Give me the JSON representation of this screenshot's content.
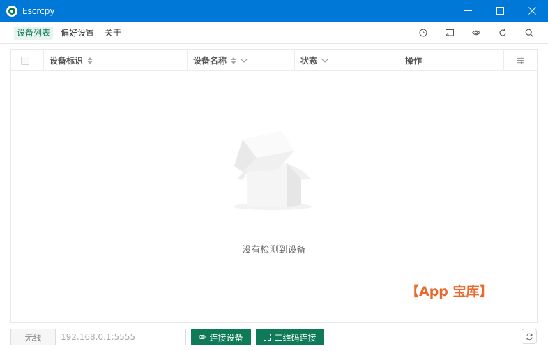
{
  "window": {
    "title": "Escrcpy",
    "controls": [
      "minimize-icon",
      "maximize-icon",
      "close-icon"
    ]
  },
  "menu": {
    "items": [
      {
        "label": "设备列表",
        "active": true
      },
      {
        "label": "偏好设置",
        "active": false
      },
      {
        "label": "关于",
        "active": false
      }
    ],
    "tools": [
      "history-icon",
      "screen-cast-icon",
      "eye-icon",
      "refresh-icon",
      "search-icon"
    ]
  },
  "table": {
    "columns": [
      {
        "label": "设备标识",
        "sortable": true,
        "filterable": false
      },
      {
        "label": "设备名称",
        "sortable": true,
        "filterable": true
      },
      {
        "label": "状态",
        "sortable": false,
        "filterable": true
      },
      {
        "label": "操作",
        "sortable": false,
        "filterable": false
      }
    ],
    "settings_icon": "sliders-icon",
    "empty_text": "没有检测到设备"
  },
  "watermark": "【App 宝库】",
  "footer": {
    "mode_label": "无线",
    "ip_placeholder": "192.168.0.1:5555",
    "connect_button": "连接设备",
    "qr_button": "二维码连接",
    "accent": "#0e7a57"
  },
  "colors": {
    "titlebar": "#0078d7",
    "accent": "#0e7a57",
    "watermark": "#e8692c"
  }
}
